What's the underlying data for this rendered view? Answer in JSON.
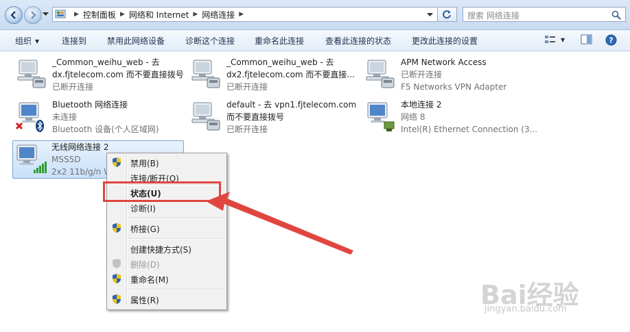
{
  "address": {
    "crumbs": [
      "控制面板",
      "网络和 Internet",
      "网络连接"
    ],
    "search_placeholder": "搜索 网络连接"
  },
  "toolbar": {
    "organize": "组织",
    "connect_to": "连接到",
    "disable": "禁用此网络设备",
    "diagnose": "诊断这个连接",
    "rename": "重命名此连接",
    "view_status": "查看此连接的状态",
    "change_settings": "更改此连接的设置"
  },
  "connections": [
    {
      "name": "_Common_weihu_web - 去",
      "line2": "dx.fjtelecom.com 而不要直接拨号",
      "status": "已断开连接"
    },
    {
      "name": "_Common_weihu_web - 去",
      "line2": "dx2.fjtelecom.com 而不要直接...",
      "status": "已断开连接"
    },
    {
      "name": "APM Network Access",
      "line2": "已断开连接",
      "status": "F5 Networks VPN Adapter"
    },
    {
      "name": "Bluetooth 网络连接",
      "line2": "未连接",
      "status": "Bluetooth 设备(个人区域网)"
    },
    {
      "name": "default - 去 vpn1.fjtelecom.com",
      "line2": "而不要直接拨号",
      "status": "已断开连接"
    },
    {
      "name": "本地连接 2",
      "line2": "网络  8",
      "status": "Intel(R) Ethernet Connection (3..."
    },
    {
      "name": "无线网络连接 2",
      "line2": "MSS5D",
      "status": "2x2 11b/g/n W"
    }
  ],
  "context_menu": {
    "items": [
      "禁用(B)",
      "连接/断开(O)",
      "状态(U)",
      "诊断(I)",
      "桥接(G)",
      "创建快捷方式(S)",
      "删除(D)",
      "重命名(M)",
      "属性(R)"
    ]
  },
  "watermark": {
    "main": "Bai经验",
    "sub": "jingyan.baidu.com"
  },
  "colors": {
    "highlight": "#e0463f",
    "selection_border": "#7da2ce"
  }
}
